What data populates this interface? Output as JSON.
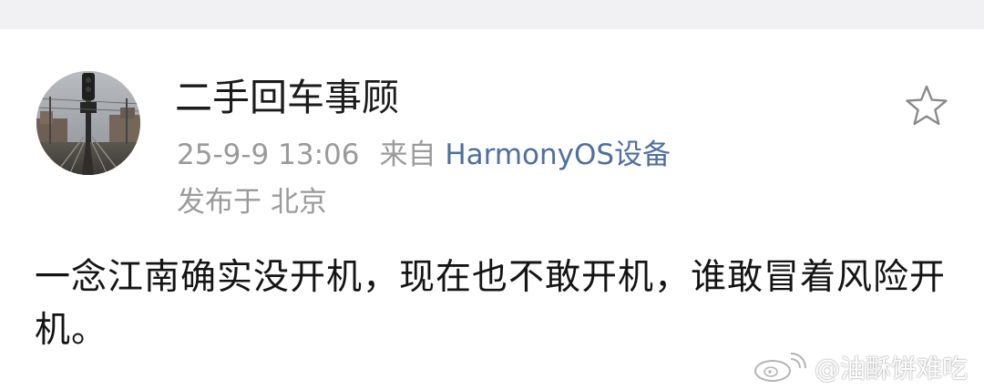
{
  "post": {
    "author": "二手回车事顾",
    "timestamp": "25-9-9 13:06",
    "source_prefix": "来自",
    "source_device": "HarmonyOS设备",
    "location": "发布于 北京",
    "text": "一念江南确实没开机，现在也不敢开机，谁敢冒着风险开机。"
  },
  "watermark": {
    "text": "@油酥饼难吃"
  },
  "icons": {
    "favorite": "star-outline-icon",
    "weibo": "weibo-logo"
  },
  "colors": {
    "background": "#ffffff",
    "top_strip": "#f1f1f3",
    "author_text": "#1b1b1b",
    "meta_text": "#9a9a9a",
    "device_link": "#4f6f9c",
    "body_text": "#141414"
  }
}
